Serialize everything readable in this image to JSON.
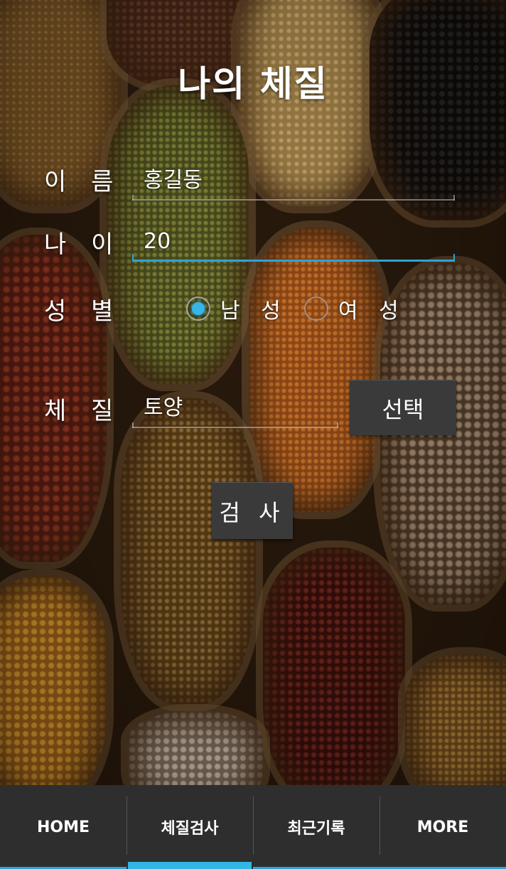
{
  "title": "나의 체질",
  "form": {
    "name_label": "이 름",
    "name_value": "홍길동",
    "age_label": "나 이",
    "age_value": "20",
    "gender_label": "성 별",
    "gender_male": "남 성",
    "gender_female": "여 성",
    "gender_selected": "male",
    "constitution_label": "체 질",
    "constitution_value": "토양",
    "select_button": "선택",
    "check_button": "검 사"
  },
  "tabs": [
    {
      "label": "HOME",
      "active": false
    },
    {
      "label": "체질검사",
      "active": true
    },
    {
      "label": "최근기록",
      "active": false
    },
    {
      "label": "MORE",
      "active": false
    }
  ],
  "colors": {
    "accent": "#33b5e5",
    "tabbar_bg": "#2e2e2e",
    "button_bg": "#3a3a3a"
  }
}
